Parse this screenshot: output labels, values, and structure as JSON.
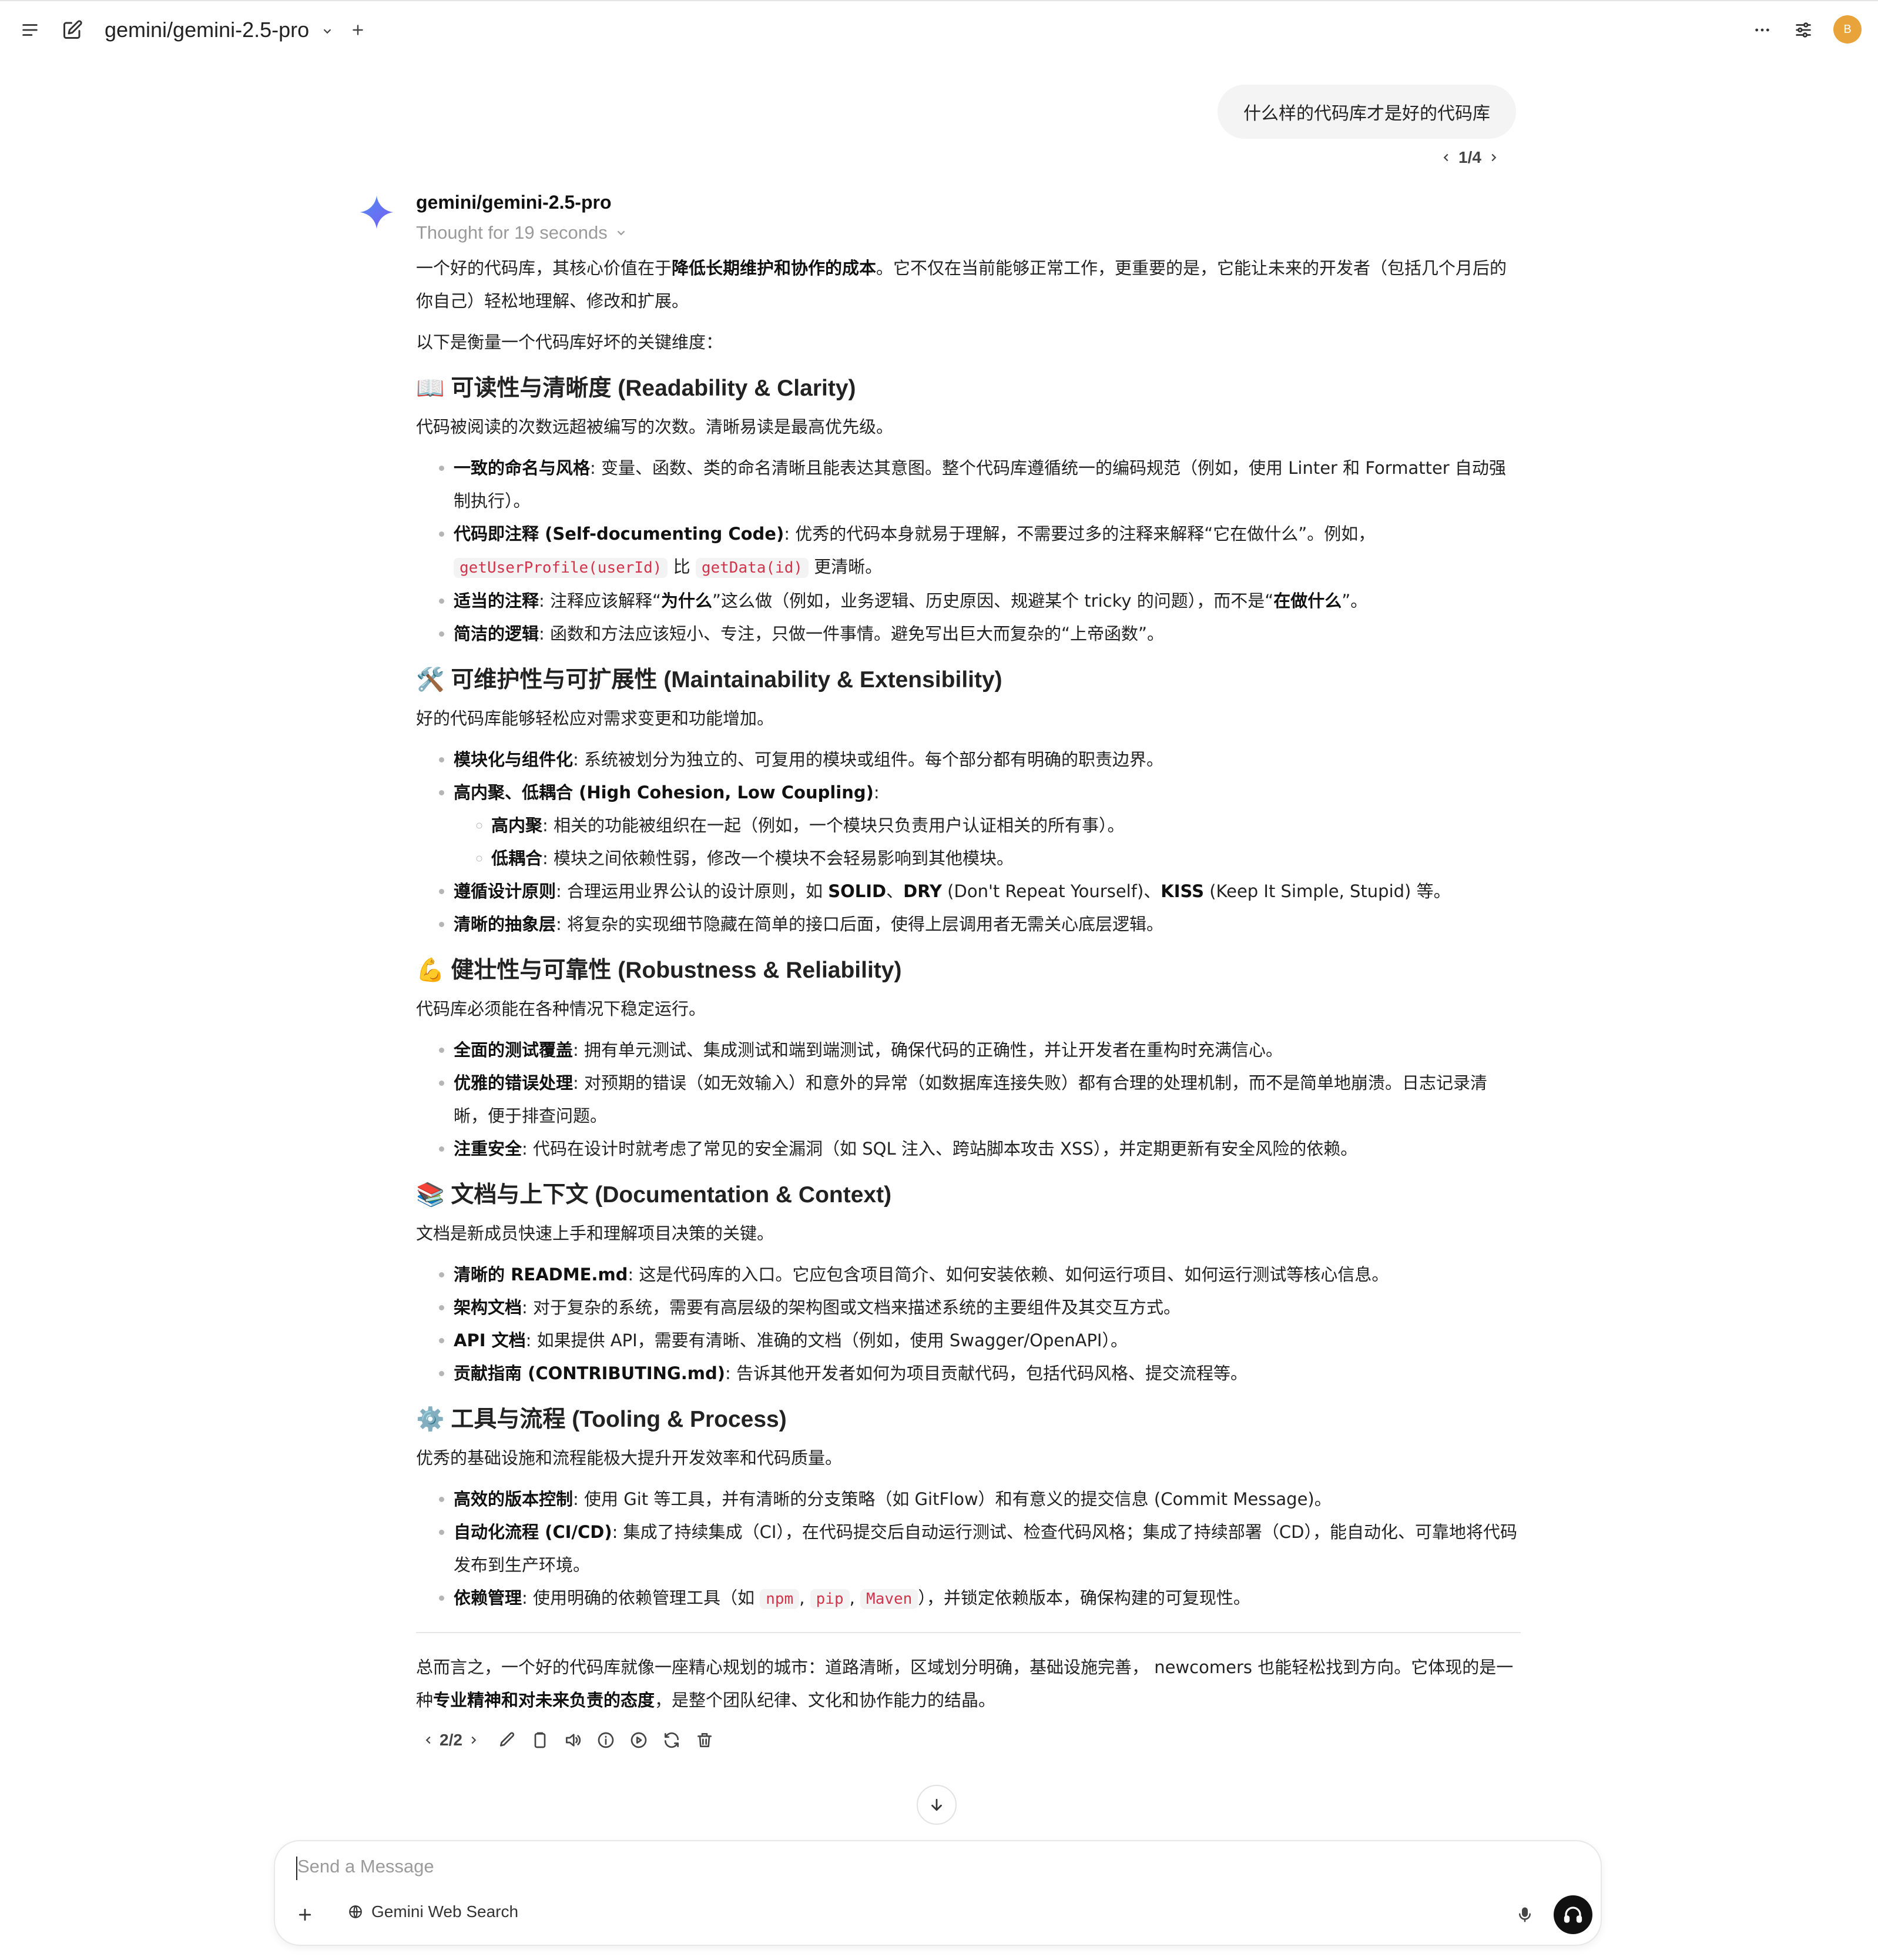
{
  "header": {
    "model_title": "gemini/gemini-2.5-pro",
    "avatar_letter": "B"
  },
  "user_message": {
    "text": "什么样的代码库才是好的代码库",
    "pager": "1/4"
  },
  "assistant": {
    "name": "gemini/gemini-2.5-pro",
    "thought": "Thought for 19 seconds",
    "intro_a": "一个好的代码库，其核心价值在于",
    "intro_b": "降低长期维护和协作的成本",
    "intro_c": "。它不仅在当前能够正常工作，更重要的是，它能让未来的开发者（包括几个月后的你自己）轻松地理解、修改和扩展。",
    "lead": "以下是衡量一个代码库好坏的关键维度：",
    "s1": {
      "emoji": "📖",
      "title": "可读性与清晰度 (Readability & Clarity)",
      "desc": "代码被阅读的次数远超被编写的次数。清晰易读是最高优先级。",
      "i1_b": "一致的命名与风格",
      "i1_t": ": 变量、函数、类的命名清晰且能表达其意图。整个代码库遵循统一的编码规范（例如，使用 Linter 和 Formatter 自动强制执行）。",
      "i2_b": "代码即注释 (Self-documenting Code)",
      "i2_t": ": 优秀的代码本身就易于理解，不需要过多的注释来解释“它在做什么”。例如，",
      "i2_c1": "getUserProfile(userId)",
      "i2_mid": "比",
      "i2_c2": "getData(id)",
      "i2_end": "更清晰。",
      "i3_b": "适当的注释",
      "i3_t1": ": 注释应该解释“",
      "i3_b2": "为什么",
      "i3_t2": "”这么做（例如，业务逻辑、历史原因、规避某个 tricky 的问题），而不是“",
      "i3_b3": "在做什么",
      "i3_t3": "”。",
      "i4_b": "简洁的逻辑",
      "i4_t": ": 函数和方法应该短小、专注，只做一件事情。避免写出巨大而复杂的“上帝函数”。"
    },
    "s2": {
      "emoji": "🛠️",
      "title": "可维护性与可扩展性 (Maintainability & Extensibility)",
      "desc": "好的代码库能够轻松应对需求变更和功能增加。",
      "i1_b": "模块化与组件化",
      "i1_t": ": 系统被划分为独立的、可复用的模块或组件。每个部分都有明确的职责边界。",
      "i2_b": "高内聚、低耦合 (High Cohesion, Low Coupling)",
      "i2_t": ":",
      "i2a_b": "高内聚",
      "i2a_t": ": 相关的功能被组织在一起（例如，一个模块只负责用户认证相关的所有事）。",
      "i2b_b": "低耦合",
      "i2b_t": ": 模块之间依赖性弱，修改一个模块不会轻易影响到其他模块。",
      "i3_b": "遵循设计原则",
      "i3_t1": ": 合理运用业界公认的设计原则，如 ",
      "i3_k1": "SOLID",
      "i3_s1": "、",
      "i3_k2": "DRY",
      "i3_t2": " (Don't Repeat Yourself)、",
      "i3_k3": "KISS",
      "i3_t3": " (Keep It Simple, Stupid) 等。",
      "i4_b": "清晰的抽象层",
      "i4_t": ": 将复杂的实现细节隐藏在简单的接口后面，使得上层调用者无需关心底层逻辑。"
    },
    "s3": {
      "emoji": "💪",
      "title": "健壮性与可靠性 (Robustness & Reliability)",
      "desc": "代码库必须能在各种情况下稳定运行。",
      "i1_b": "全面的测试覆盖",
      "i1_t": ": 拥有单元测试、集成测试和端到端测试，确保代码的正确性，并让开发者在重构时充满信心。",
      "i2_b": "优雅的错误处理",
      "i2_t": ": 对预期的错误（如无效输入）和意外的异常（如数据库连接失败）都有合理的处理机制，而不是简单地崩溃。日志记录清晰，便于排查问题。",
      "i3_b": "注重安全",
      "i3_t": ": 代码在设计时就考虑了常见的安全漏洞（如 SQL 注入、跨站脚本攻击 XSS），并定期更新有安全风险的依赖。"
    },
    "s4": {
      "emoji": "📚",
      "title": "文档与上下文 (Documentation & Context)",
      "desc": "文档是新成员快速上手和理解项目决策的关键。",
      "i1_b": "清晰的 README.md",
      "i1_t": ": 这是代码库的入口。它应包含项目简介、如何安装依赖、如何运行项目、如何运行测试等核心信息。",
      "i2_b": "架构文档",
      "i2_t": ": 对于复杂的系统，需要有高层级的架构图或文档来描述系统的主要组件及其交互方式。",
      "i3_b": "API 文档",
      "i3_t": ": 如果提供 API，需要有清晰、准确的文档（例如，使用 Swagger/OpenAPI）。",
      "i4_b": "贡献指南 (CONTRIBUTING.md)",
      "i4_t": ": 告诉其他开发者如何为项目贡献代码，包括代码风格、提交流程等。"
    },
    "s5": {
      "emoji": "⚙️",
      "title": "工具与流程 (Tooling & Process)",
      "desc": "优秀的基础设施和流程能极大提升开发效率和代码质量。",
      "i1_b": "高效的版本控制",
      "i1_t": ": 使用 Git 等工具，并有清晰的分支策略（如 GitFlow）和有意义的提交信息 (Commit Message)。",
      "i2_b": "自动化流程 (CI/CD)",
      "i2_t": ": 集成了持续集成（CI），在代码提交后自动运行测试、检查代码风格；集成了持续部署（CD），能自动化、可靠地将代码发布到生产环境。",
      "i3_b": "依赖管理",
      "i3_t1": ": 使用明确的依赖管理工具（如 ",
      "i3_c1": "npm",
      "i3_sep1": ", ",
      "i3_c2": "pip",
      "i3_sep2": ", ",
      "i3_c3": "Maven",
      "i3_t2": "），并锁定依赖版本，确保构建的可复现性。"
    },
    "summary_a": "总而言之，一个好的代码库就像一座精心规划的城市：道路清晰，区域划分明确，基础设施完善， newcomers 也能轻松找到方向。它体现的是一种",
    "summary_b": "专业精神和对未来负责的态度",
    "summary_c": "，是整个团队纪律、文化和协作能力的结晶。",
    "pager": "2/2"
  },
  "composer": {
    "placeholder": "Send a Message",
    "web_search_label": "Gemini Web Search"
  },
  "colors": {
    "accent_avatar": "#e8a33a",
    "code_text": "#d1344b",
    "voice_button": "#111111"
  }
}
